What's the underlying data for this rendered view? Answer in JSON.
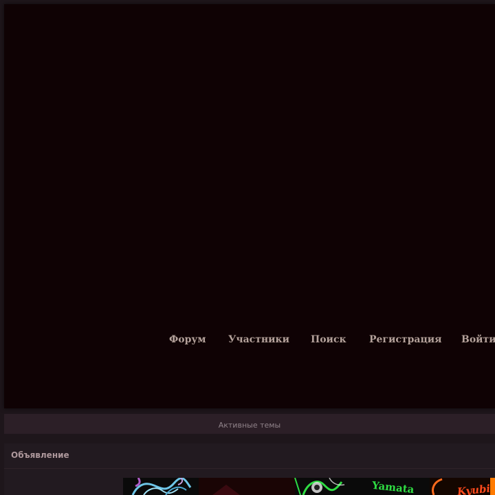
{
  "nav": {
    "items": [
      {
        "label": "Форум"
      },
      {
        "label": "Участники"
      },
      {
        "label": "Поиск"
      },
      {
        "label": "Регистрация"
      },
      {
        "label": "Войти"
      }
    ]
  },
  "active_topics": {
    "label": "Активные темы"
  },
  "announcement": {
    "title": "Объявление",
    "banner": {
      "captions": [
        "Yamata",
        "Kyubi"
      ]
    }
  },
  "colors": {
    "page_background": "#1e161b",
    "header_background": "#0f0204",
    "nav_text": "#b3a19a",
    "bar_background": "#2c1f27",
    "muted_text": "#8f8289",
    "announce_background": "#221a20",
    "announce_title": "#ad979b",
    "banner_green": "#2fdc43",
    "banner_orange": "#ff4a1c",
    "banner_blue": "#6ec6e8"
  }
}
